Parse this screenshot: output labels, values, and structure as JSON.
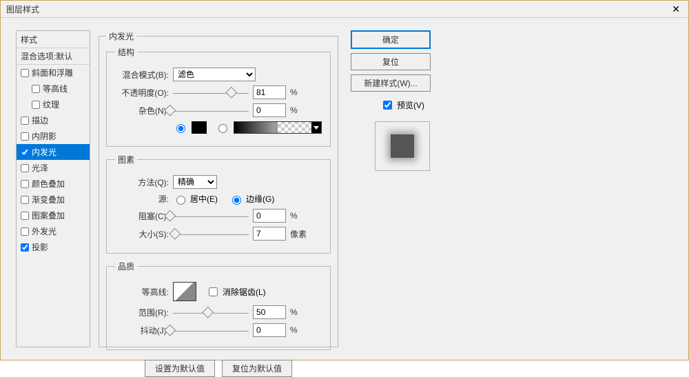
{
  "title": "图层样式",
  "sidebar": {
    "header": "样式",
    "blend_options": "混合选项:默认",
    "items": [
      {
        "label": "斜面和浮雕",
        "checked": false,
        "selected": false
      },
      {
        "label": "等高线",
        "checked": false,
        "selected": false,
        "indent": true
      },
      {
        "label": "纹理",
        "checked": false,
        "selected": false,
        "indent": true
      },
      {
        "label": "描边",
        "checked": false,
        "selected": false
      },
      {
        "label": "内阴影",
        "checked": false,
        "selected": false
      },
      {
        "label": "内发光",
        "checked": true,
        "selected": true
      },
      {
        "label": "光泽",
        "checked": false,
        "selected": false
      },
      {
        "label": "颜色叠加",
        "checked": false,
        "selected": false
      },
      {
        "label": "渐变叠加",
        "checked": false,
        "selected": false
      },
      {
        "label": "图案叠加",
        "checked": false,
        "selected": false
      },
      {
        "label": "外发光",
        "checked": false,
        "selected": false
      },
      {
        "label": "投影",
        "checked": true,
        "selected": false
      }
    ]
  },
  "panel_title": "内发光",
  "structure": {
    "legend": "结构",
    "blend_mode_label": "混合模式(B):",
    "blend_mode_value": "滤色",
    "opacity_label": "不透明度(O):",
    "opacity_value": "81",
    "opacity_unit": "%",
    "noise_label": "杂色(N):",
    "noise_value": "0",
    "noise_unit": "%"
  },
  "elements": {
    "legend": "图素",
    "technique_label": "方法(Q):",
    "technique_value": "精确",
    "source_label": "源:",
    "source_center": "居中(E)",
    "source_edge": "边缘(G)",
    "choke_label": "阻塞(C):",
    "choke_value": "0",
    "choke_unit": "%",
    "size_label": "大小(S):",
    "size_value": "7",
    "size_unit": "像素"
  },
  "quality": {
    "legend": "品质",
    "contour_label": "等高线:",
    "antialias_label": "消除锯齿(L)",
    "range_label": "范围(R):",
    "range_value": "50",
    "range_unit": "%",
    "jitter_label": "抖动(J):",
    "jitter_value": "0",
    "jitter_unit": "%"
  },
  "footer": {
    "make_default": "设置为默认值",
    "reset_default": "复位为默认值"
  },
  "right": {
    "ok": "确定",
    "cancel": "复位",
    "new_style": "新建样式(W)...",
    "preview": "预览(V)"
  }
}
